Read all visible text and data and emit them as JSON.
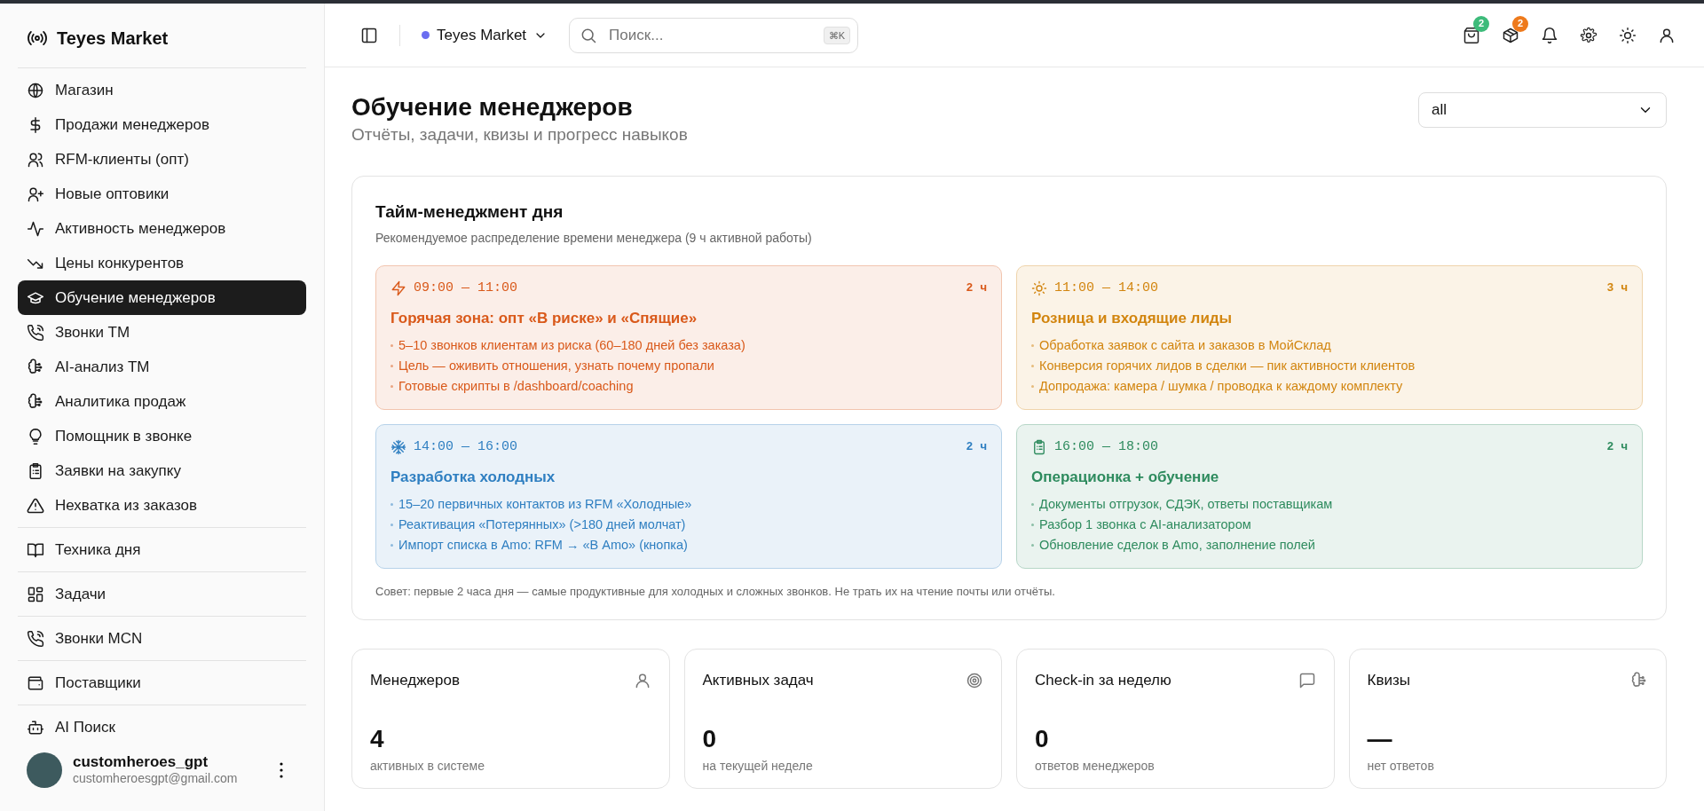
{
  "sidebar": {
    "brand": "Teyes Market",
    "sections": [
      {
        "items": [
          {
            "label": "Магазин",
            "selected": false
          },
          {
            "label": "Продажи менеджеров",
            "selected": false
          },
          {
            "label": "RFM-клиенты (опт)",
            "selected": false
          },
          {
            "label": "Новые оптовики",
            "selected": false
          },
          {
            "label": "Активность менеджеров",
            "selected": false
          },
          {
            "label": "Цены конкурентов",
            "selected": false
          },
          {
            "label": "Обучение менеджеров",
            "selected": true
          },
          {
            "label": "Звонки ТМ",
            "selected": false
          },
          {
            "label": "AI-анализ ТМ",
            "selected": false
          },
          {
            "label": "Аналитика продаж",
            "selected": false
          },
          {
            "label": "Помощник в звонке",
            "selected": false
          },
          {
            "label": "Заявки на закупку",
            "selected": false
          },
          {
            "label": "Нехватка из заказов",
            "selected": false
          }
        ]
      },
      {
        "items": [
          {
            "label": "Техника дня",
            "selected": false
          }
        ]
      },
      {
        "items": [
          {
            "label": "Задачи",
            "selected": false
          }
        ]
      },
      {
        "items": [
          {
            "label": "Звонки MCN",
            "selected": false
          }
        ]
      },
      {
        "items": [
          {
            "label": "Поставщики",
            "selected": false
          }
        ]
      },
      {
        "items": [
          {
            "label": "AI Поиск",
            "selected": false
          }
        ]
      }
    ],
    "user": {
      "name": "customheroes_gpt",
      "email": "customheroesgpt@gmail.com"
    }
  },
  "header": {
    "store": {
      "name": "Teyes Market",
      "color": "#6b6ef0"
    },
    "search": {
      "placeholder": "Поиск...",
      "shortcut": "⌘K"
    },
    "badges": [
      {
        "count": "2",
        "color": "#3dbb7a"
      },
      {
        "count": "2",
        "color": "#ee7a1c"
      }
    ]
  },
  "page": {
    "title": "Обучение менеджеров",
    "subtitle": "Отчёты, задачи, квизы и прогресс навыков",
    "filter": {
      "value": "all"
    }
  },
  "schedule": {
    "title": "Тайм-менеджмент дня",
    "subtitle": "Рекомендуемое распределение времени менеджера (9 ч активной работы)",
    "blocks": [
      {
        "time": "09:00 — 11:00",
        "duration": "2 ч",
        "title": "Горячая зона: опт «В риске» и «Спящие»",
        "color": "#d9591a",
        "points": [
          "5–10 звонков клиентам из риска (60–180 дней без заказа)",
          "Цель — оживить отношения, узнать почему пропали",
          "Готовые скрипты в /dashboard/coaching"
        ]
      },
      {
        "time": "11:00 — 14:00",
        "duration": "3 ч",
        "title": "Розница и входящие лиды",
        "color": "#d2850f",
        "points": [
          "Обработка заявок с сайта и заказов в МойСклад",
          "Конверсия горячих лидов в сделки — пик активности клиентов",
          "Допродажа: камера / шумка / проводка к каждому комплекту"
        ]
      },
      {
        "time": "14:00 — 16:00",
        "duration": "2 ч",
        "title": "Разработка холодных",
        "color": "#2f7fc1",
        "points": [
          "15–20 первичных контактов из RFM «Холодные»",
          "Реактивация «Потерянных» (>180 дней молчат)",
          "Импорт списка в Amo: RFM → «В Amo» (кнопка)"
        ]
      },
      {
        "time": "16:00 — 18:00",
        "duration": "2 ч",
        "title": "Операционка + обучение",
        "color": "#2e8b5e",
        "points": [
          "Документы отгрузок, СДЭК, ответы поставщикам",
          "Разбор 1 звонка с AI-анализатором",
          "Обновление сделок в Amo, заполнение полей"
        ]
      }
    ],
    "tip": "Совет: первые 2 часа дня — самые продуктивные для холодных и сложных звонков. Не трать их на чтение почты или отчёты."
  },
  "stats": [
    {
      "label": "Менеджеров",
      "value": "4",
      "note": "активных в системе"
    },
    {
      "label": "Активных задач",
      "value": "0",
      "note": "на текущей неделе"
    },
    {
      "label": "Check-in за неделю",
      "value": "0",
      "note": "ответов менеджеров"
    },
    {
      "label": "Квизы",
      "value": "—",
      "note": "нет ответов"
    }
  ]
}
